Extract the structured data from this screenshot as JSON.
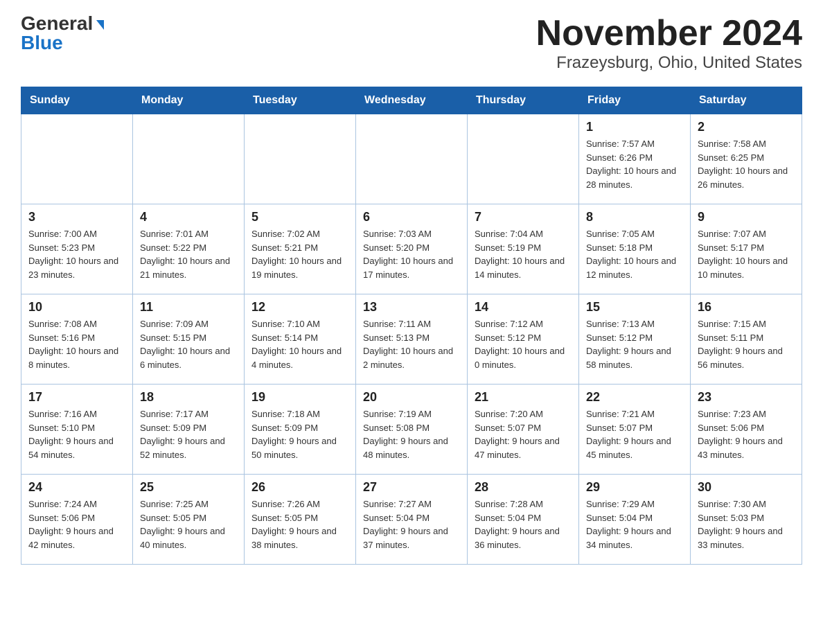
{
  "logo": {
    "general": "General",
    "triangle": "▶",
    "blue": "Blue"
  },
  "title": "November 2024",
  "subtitle": "Frazeysburg, Ohio, United States",
  "days_of_week": [
    "Sunday",
    "Monday",
    "Tuesday",
    "Wednesday",
    "Thursday",
    "Friday",
    "Saturday"
  ],
  "weeks": [
    [
      {
        "day": "",
        "sunrise": "",
        "sunset": "",
        "daylight": ""
      },
      {
        "day": "",
        "sunrise": "",
        "sunset": "",
        "daylight": ""
      },
      {
        "day": "",
        "sunrise": "",
        "sunset": "",
        "daylight": ""
      },
      {
        "day": "",
        "sunrise": "",
        "sunset": "",
        "daylight": ""
      },
      {
        "day": "",
        "sunrise": "",
        "sunset": "",
        "daylight": ""
      },
      {
        "day": "1",
        "sunrise": "Sunrise: 7:57 AM",
        "sunset": "Sunset: 6:26 PM",
        "daylight": "Daylight: 10 hours and 28 minutes."
      },
      {
        "day": "2",
        "sunrise": "Sunrise: 7:58 AM",
        "sunset": "Sunset: 6:25 PM",
        "daylight": "Daylight: 10 hours and 26 minutes."
      }
    ],
    [
      {
        "day": "3",
        "sunrise": "Sunrise: 7:00 AM",
        "sunset": "Sunset: 5:23 PM",
        "daylight": "Daylight: 10 hours and 23 minutes."
      },
      {
        "day": "4",
        "sunrise": "Sunrise: 7:01 AM",
        "sunset": "Sunset: 5:22 PM",
        "daylight": "Daylight: 10 hours and 21 minutes."
      },
      {
        "day": "5",
        "sunrise": "Sunrise: 7:02 AM",
        "sunset": "Sunset: 5:21 PM",
        "daylight": "Daylight: 10 hours and 19 minutes."
      },
      {
        "day": "6",
        "sunrise": "Sunrise: 7:03 AM",
        "sunset": "Sunset: 5:20 PM",
        "daylight": "Daylight: 10 hours and 17 minutes."
      },
      {
        "day": "7",
        "sunrise": "Sunrise: 7:04 AM",
        "sunset": "Sunset: 5:19 PM",
        "daylight": "Daylight: 10 hours and 14 minutes."
      },
      {
        "day": "8",
        "sunrise": "Sunrise: 7:05 AM",
        "sunset": "Sunset: 5:18 PM",
        "daylight": "Daylight: 10 hours and 12 minutes."
      },
      {
        "day": "9",
        "sunrise": "Sunrise: 7:07 AM",
        "sunset": "Sunset: 5:17 PM",
        "daylight": "Daylight: 10 hours and 10 minutes."
      }
    ],
    [
      {
        "day": "10",
        "sunrise": "Sunrise: 7:08 AM",
        "sunset": "Sunset: 5:16 PM",
        "daylight": "Daylight: 10 hours and 8 minutes."
      },
      {
        "day": "11",
        "sunrise": "Sunrise: 7:09 AM",
        "sunset": "Sunset: 5:15 PM",
        "daylight": "Daylight: 10 hours and 6 minutes."
      },
      {
        "day": "12",
        "sunrise": "Sunrise: 7:10 AM",
        "sunset": "Sunset: 5:14 PM",
        "daylight": "Daylight: 10 hours and 4 minutes."
      },
      {
        "day": "13",
        "sunrise": "Sunrise: 7:11 AM",
        "sunset": "Sunset: 5:13 PM",
        "daylight": "Daylight: 10 hours and 2 minutes."
      },
      {
        "day": "14",
        "sunrise": "Sunrise: 7:12 AM",
        "sunset": "Sunset: 5:12 PM",
        "daylight": "Daylight: 10 hours and 0 minutes."
      },
      {
        "day": "15",
        "sunrise": "Sunrise: 7:13 AM",
        "sunset": "Sunset: 5:12 PM",
        "daylight": "Daylight: 9 hours and 58 minutes."
      },
      {
        "day": "16",
        "sunrise": "Sunrise: 7:15 AM",
        "sunset": "Sunset: 5:11 PM",
        "daylight": "Daylight: 9 hours and 56 minutes."
      }
    ],
    [
      {
        "day": "17",
        "sunrise": "Sunrise: 7:16 AM",
        "sunset": "Sunset: 5:10 PM",
        "daylight": "Daylight: 9 hours and 54 minutes."
      },
      {
        "day": "18",
        "sunrise": "Sunrise: 7:17 AM",
        "sunset": "Sunset: 5:09 PM",
        "daylight": "Daylight: 9 hours and 52 minutes."
      },
      {
        "day": "19",
        "sunrise": "Sunrise: 7:18 AM",
        "sunset": "Sunset: 5:09 PM",
        "daylight": "Daylight: 9 hours and 50 minutes."
      },
      {
        "day": "20",
        "sunrise": "Sunrise: 7:19 AM",
        "sunset": "Sunset: 5:08 PM",
        "daylight": "Daylight: 9 hours and 48 minutes."
      },
      {
        "day": "21",
        "sunrise": "Sunrise: 7:20 AM",
        "sunset": "Sunset: 5:07 PM",
        "daylight": "Daylight: 9 hours and 47 minutes."
      },
      {
        "day": "22",
        "sunrise": "Sunrise: 7:21 AM",
        "sunset": "Sunset: 5:07 PM",
        "daylight": "Daylight: 9 hours and 45 minutes."
      },
      {
        "day": "23",
        "sunrise": "Sunrise: 7:23 AM",
        "sunset": "Sunset: 5:06 PM",
        "daylight": "Daylight: 9 hours and 43 minutes."
      }
    ],
    [
      {
        "day": "24",
        "sunrise": "Sunrise: 7:24 AM",
        "sunset": "Sunset: 5:06 PM",
        "daylight": "Daylight: 9 hours and 42 minutes."
      },
      {
        "day": "25",
        "sunrise": "Sunrise: 7:25 AM",
        "sunset": "Sunset: 5:05 PM",
        "daylight": "Daylight: 9 hours and 40 minutes."
      },
      {
        "day": "26",
        "sunrise": "Sunrise: 7:26 AM",
        "sunset": "Sunset: 5:05 PM",
        "daylight": "Daylight: 9 hours and 38 minutes."
      },
      {
        "day": "27",
        "sunrise": "Sunrise: 7:27 AM",
        "sunset": "Sunset: 5:04 PM",
        "daylight": "Daylight: 9 hours and 37 minutes."
      },
      {
        "day": "28",
        "sunrise": "Sunrise: 7:28 AM",
        "sunset": "Sunset: 5:04 PM",
        "daylight": "Daylight: 9 hours and 36 minutes."
      },
      {
        "day": "29",
        "sunrise": "Sunrise: 7:29 AM",
        "sunset": "Sunset: 5:04 PM",
        "daylight": "Daylight: 9 hours and 34 minutes."
      },
      {
        "day": "30",
        "sunrise": "Sunrise: 7:30 AM",
        "sunset": "Sunset: 5:03 PM",
        "daylight": "Daylight: 9 hours and 33 minutes."
      }
    ]
  ]
}
